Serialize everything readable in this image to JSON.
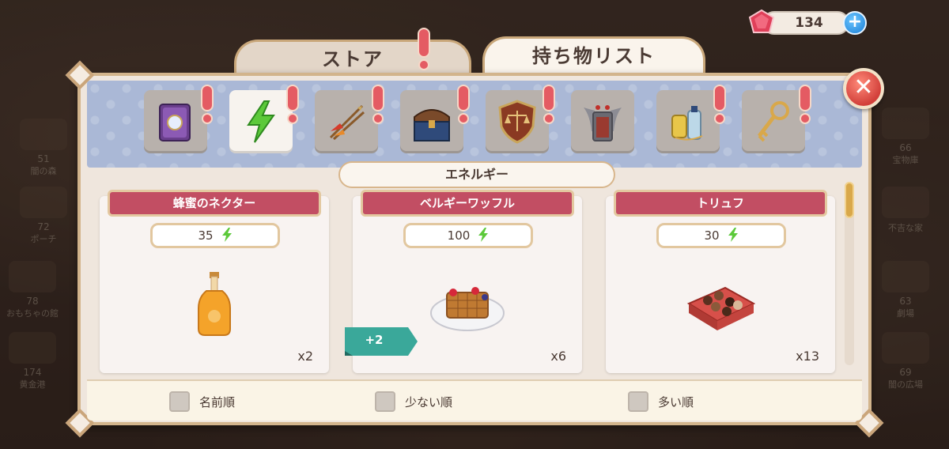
{
  "currency": {
    "amount": "134",
    "gem_icon": "ruby-gem-icon",
    "add_label": "+"
  },
  "tabs": [
    {
      "label": "ストア",
      "alert": true
    },
    {
      "label": "持ち物リスト",
      "active": true
    }
  ],
  "close_label": "✕",
  "categories": [
    {
      "icon": "spellbook-icon",
      "alert": true,
      "active": false
    },
    {
      "icon": "energy-bolt-icon",
      "alert": true,
      "active": true
    },
    {
      "icon": "feather-arrows-icon",
      "alert": true,
      "active": false
    },
    {
      "icon": "treasure-chest-icon",
      "alert": true,
      "active": false
    },
    {
      "icon": "justice-shield-icon",
      "alert": true,
      "active": false
    },
    {
      "icon": "winged-frame-icon",
      "alert": false,
      "active": false
    },
    {
      "icon": "potion-bottles-icon",
      "alert": true,
      "active": false
    },
    {
      "icon": "golden-key-icon",
      "alert": true,
      "active": false
    }
  ],
  "section_label": "エネルギー",
  "items": [
    {
      "name": "蜂蜜のネクター",
      "energy": "35",
      "count": "x2",
      "image": "honey-nectar-bottle"
    },
    {
      "name": "ベルギーワッフル",
      "energy": "100",
      "count": "x6",
      "image": "belgian-waffle-plate",
      "bonus": "+2"
    },
    {
      "name": "トリュフ",
      "energy": "30",
      "count": "x13",
      "image": "truffle-box"
    }
  ],
  "sort_options": [
    {
      "label": "名前順",
      "checked": false
    },
    {
      "label": "少ない順",
      "checked": false
    },
    {
      "label": "多い順",
      "checked": false
    }
  ],
  "background_locations": [
    {
      "num": "51",
      "name": "闇の森"
    },
    {
      "num": "72",
      "name": "ポーチ"
    },
    {
      "num": "78",
      "name": "おもちゃの館"
    },
    {
      "num": "174",
      "name": "黄金港"
    },
    {
      "num": "66",
      "name": "宝物庫"
    },
    {
      "num": "",
      "name": "不吉な家"
    },
    {
      "num": "63",
      "name": "劇場"
    },
    {
      "num": "69",
      "name": "闇の広場"
    }
  ],
  "colors": {
    "accent_red": "#c24e63",
    "panel_bg": "#efe6dd",
    "category_bar": "#aab8d6",
    "gold_border": "#d2b48c",
    "energy_green": "#5cc93a"
  }
}
